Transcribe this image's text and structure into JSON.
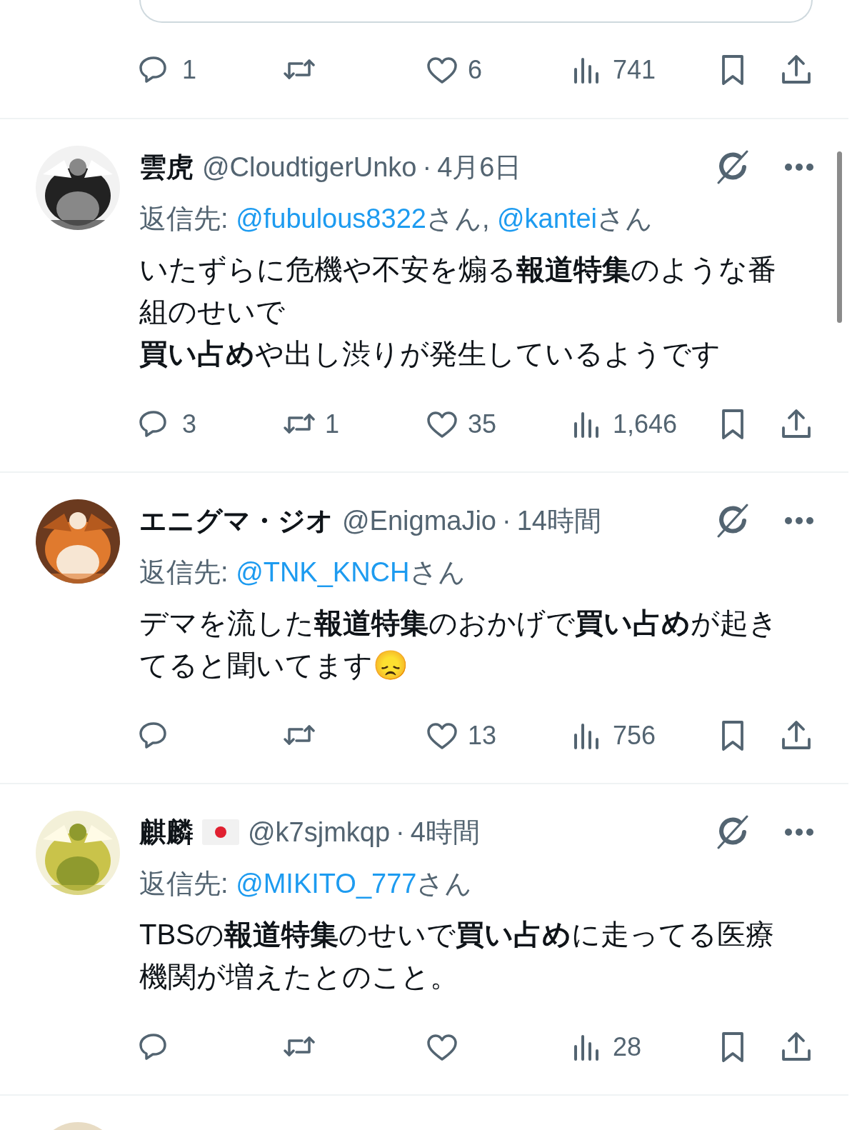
{
  "top_tweet": {
    "media_card": {
      "kind": "picture"
    },
    "actions": [
      {
        "kind": "reply",
        "count": "1"
      },
      {
        "kind": "repost"
      },
      {
        "kind": "like",
        "count": "6"
      },
      {
        "kind": "views",
        "count": "741"
      },
      {
        "kind": "bookmark"
      },
      {
        "kind": "share"
      }
    ]
  },
  "tweets": [
    {
      "avatar": {
        "kind": "picture"
      },
      "display_name": "雲虎",
      "handle": "@CloudtigerUnko",
      "separator": "·",
      "time": "4月6日",
      "reply_prefix": "返信先: ",
      "reply_parts": [
        {
          "kind": "mention",
          "text": "@fubulous8322"
        },
        {
          "kind": "plain",
          "text": "さん, "
        },
        {
          "kind": "mention",
          "text": "@kantei"
        },
        {
          "kind": "plain",
          "text": "さん"
        }
      ],
      "body": [
        "いたずらに危機や不安を煽る**報道特集**のような番組のせいで",
        "**買い占め**や出し渋りが発生しているようです"
      ],
      "actions": [
        {
          "kind": "reply",
          "count": "3"
        },
        {
          "kind": "repost",
          "count": "1"
        },
        {
          "kind": "like",
          "count": "35"
        },
        {
          "kind": "views",
          "count": "1,646"
        },
        {
          "kind": "bookmark"
        },
        {
          "kind": "share"
        }
      ]
    },
    {
      "avatar": {
        "kind": "picture"
      },
      "display_name": "エニグマ・ジオ",
      "handle": "@EnigmaJio",
      "separator": "·",
      "time": "14時間",
      "reply_prefix": "返信先: ",
      "reply_parts": [
        {
          "kind": "mention",
          "text": "@TNK_KNCH"
        },
        {
          "kind": "plain",
          "text": "さん"
        }
      ],
      "body": [
        "デマを流した**報道特集**のおかげで**買い占め**が起きてると聞いてます😞"
      ],
      "actions": [
        {
          "kind": "reply"
        },
        {
          "kind": "repost"
        },
        {
          "kind": "like",
          "count": "13"
        },
        {
          "kind": "views",
          "count": "756"
        },
        {
          "kind": "bookmark"
        },
        {
          "kind": "share"
        }
      ]
    },
    {
      "avatar": {
        "kind": "picture"
      },
      "display_name": "麒麟",
      "name_badge": {
        "kind": "flag"
      },
      "handle": "@k7sjmkqp",
      "separator": "·",
      "time": "4時間",
      "reply_prefix": "返信先: ",
      "reply_parts": [
        {
          "kind": "mention",
          "text": "@MIKITO_777"
        },
        {
          "kind": "plain",
          "text": "さん"
        }
      ],
      "body": [
        "TBSの**報道特集**のせいで**買い占め**に走ってる医療機関が増えたとのこと。"
      ],
      "actions": [
        {
          "kind": "reply"
        },
        {
          "kind": "repost"
        },
        {
          "kind": "like"
        },
        {
          "kind": "views",
          "count": "28"
        },
        {
          "kind": "bookmark"
        },
        {
          "kind": "share"
        }
      ]
    }
  ],
  "partial_tweet": {
    "avatar": {
      "kind": "picture"
    }
  }
}
